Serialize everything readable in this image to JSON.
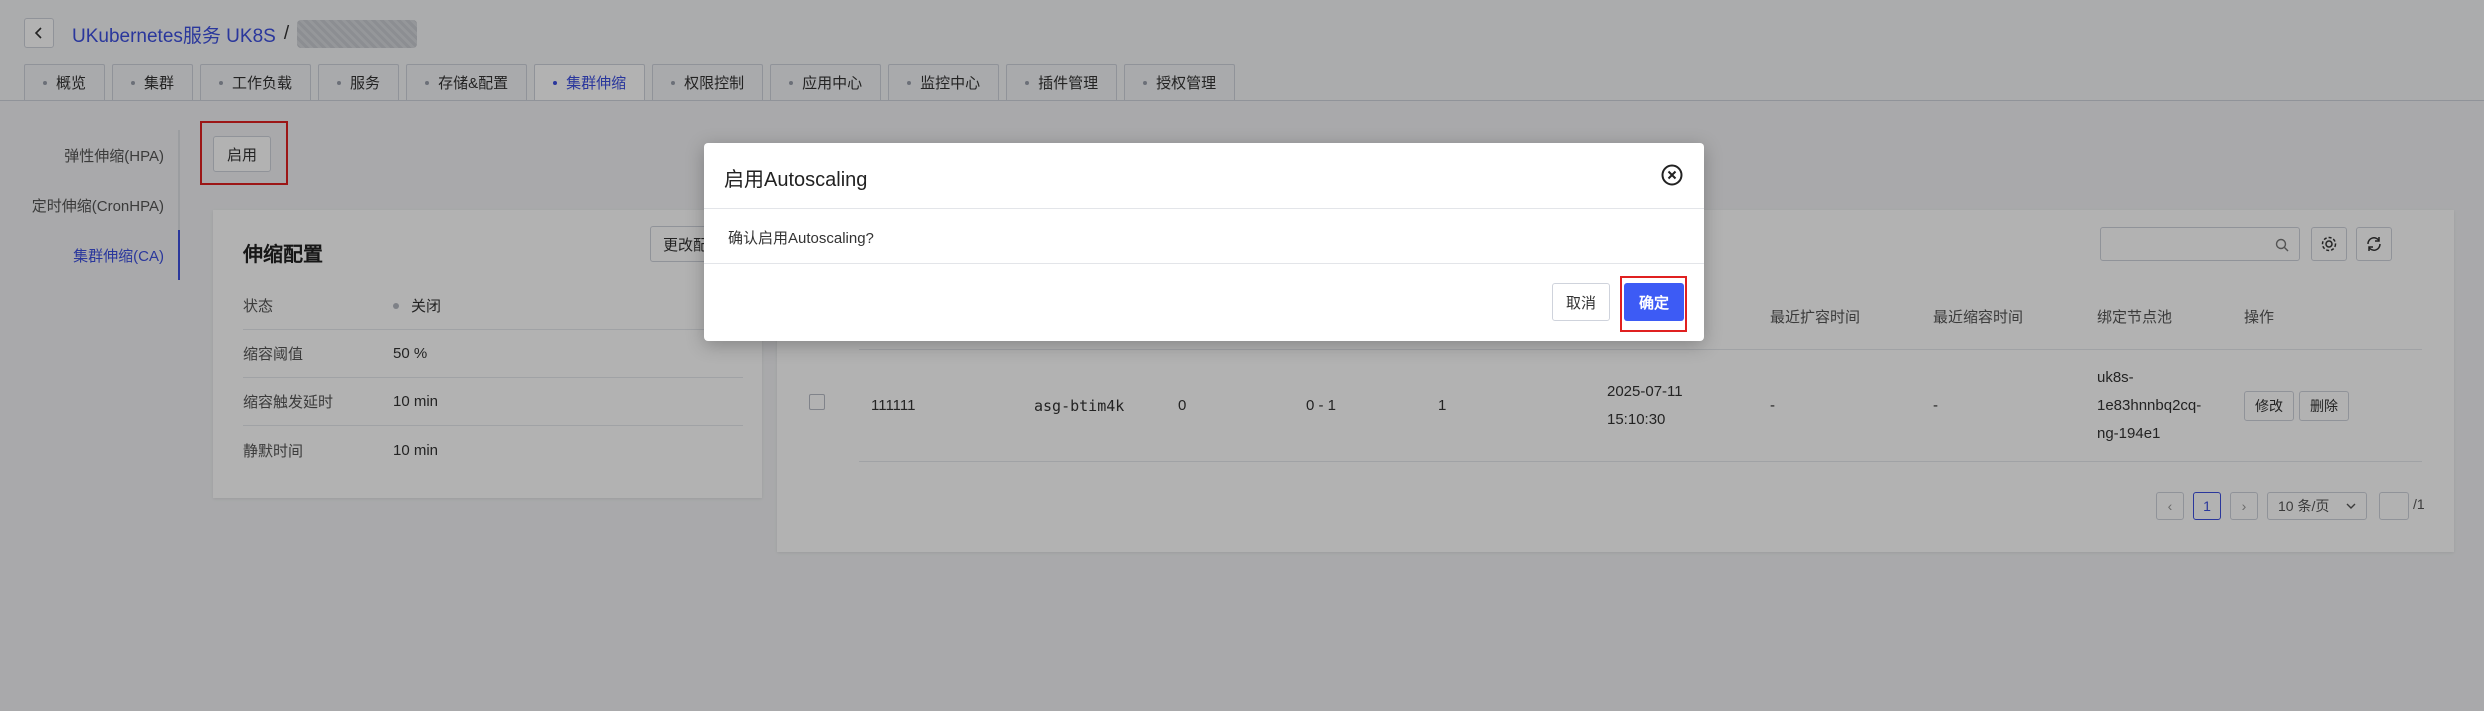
{
  "header": {
    "breadcrumb_root": "UKubernetes服务 UK8S",
    "breadcrumb_sep": "/",
    "tabs": [
      "概览",
      "集群",
      "工作负载",
      "服务",
      "存储&配置",
      "集群伸缩",
      "权限控制",
      "应用中心",
      "监控中心",
      "插件管理",
      "授权管理"
    ],
    "active_tab": "集群伸缩"
  },
  "sidebar": {
    "items": [
      "弹性伸缩(HPA)",
      "定时伸缩(CronHPA)",
      "集群伸缩(CA)"
    ],
    "active": "集群伸缩(CA)"
  },
  "toolbar": {
    "enable_label": "启用"
  },
  "config_card": {
    "title": "伸缩配置",
    "edit_label": "更改配置",
    "rows": [
      {
        "key": "状态",
        "value": "关闭"
      },
      {
        "key": "缩容阈值",
        "value": "50 %"
      },
      {
        "key": "缩容触发延时",
        "value": "10 min"
      },
      {
        "key": "静默时间",
        "value": "10 min"
      }
    ]
  },
  "table": {
    "visible_headers": [
      "最近扩容时间",
      "最近缩容时间",
      "绑定节点池",
      "操作"
    ],
    "row": {
      "name": "111111",
      "asg": "asg-btim4k",
      "current": "0",
      "range": "0 - 1",
      "count": "1",
      "created_date": "2025-07-11",
      "created_time": "15:10:30",
      "last_scale_up": "-",
      "last_scale_down": "-",
      "pool_line1": "uk8s-",
      "pool_line2": "1e83hnnbq2cq-",
      "pool_line3": "ng-194e1",
      "edit_label": "修改",
      "delete_label": "删除"
    },
    "pagination": {
      "prev": "‹",
      "page": "1",
      "next": "›",
      "page_size": "10 条/页",
      "total": "/1"
    }
  },
  "modal": {
    "title": "启用Autoscaling",
    "message": "确认启用Autoscaling?",
    "cancel_label": "取消",
    "confirm_label": "确定"
  },
  "colors": {
    "accent": "#3d4fe0",
    "confirm": "#3d5bf5",
    "highlight": "#e02020"
  }
}
